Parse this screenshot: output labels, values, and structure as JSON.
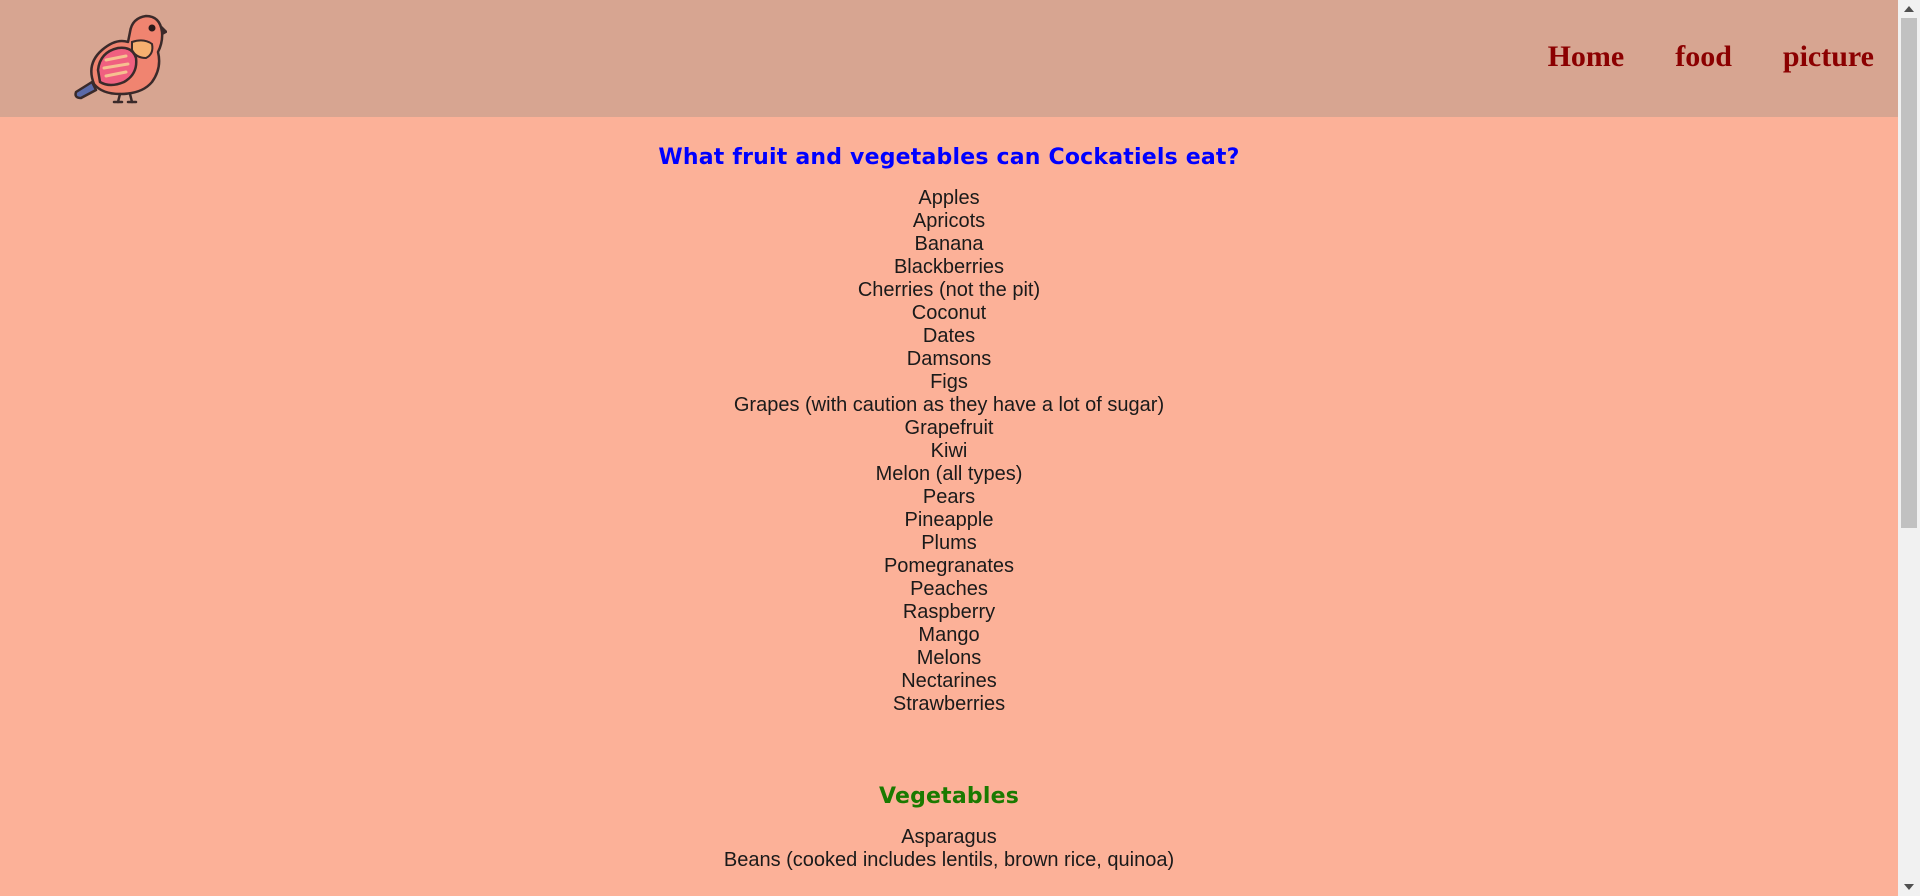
{
  "nav": {
    "home_label": "Home",
    "food_label": "food",
    "picture_label": "picture"
  },
  "fruit_section": {
    "title": "What fruit and vegetables can Cockatiels eat?",
    "items": [
      "Apples",
      "Apricots",
      "Banana",
      "Blackberries",
      "Cherries (not the pit)",
      "Coconut",
      "Dates",
      "Damsons",
      "Figs",
      "Grapes (with caution as they have a lot of sugar)",
      "Grapefruit",
      "Kiwi",
      "Melon (all types)",
      "Pears",
      "Pineapple",
      "Plums",
      "Pomegranates",
      "Peaches",
      "Raspberry",
      "Mango",
      "Melons",
      "Nectarines",
      "Strawberries"
    ]
  },
  "vegetable_section": {
    "title": "Vegetables",
    "items": [
      "Asparagus",
      "Beans (cooked includes lentils, brown rice, quinoa)"
    ]
  },
  "colors": {
    "header_bg": "#d7a591",
    "page_bg": "#fcb198",
    "nav_link": "#8b0000",
    "fruit_title": "#0000ff",
    "veg_title": "#1a7a00"
  },
  "icons": {
    "logo": "bird-icon"
  }
}
